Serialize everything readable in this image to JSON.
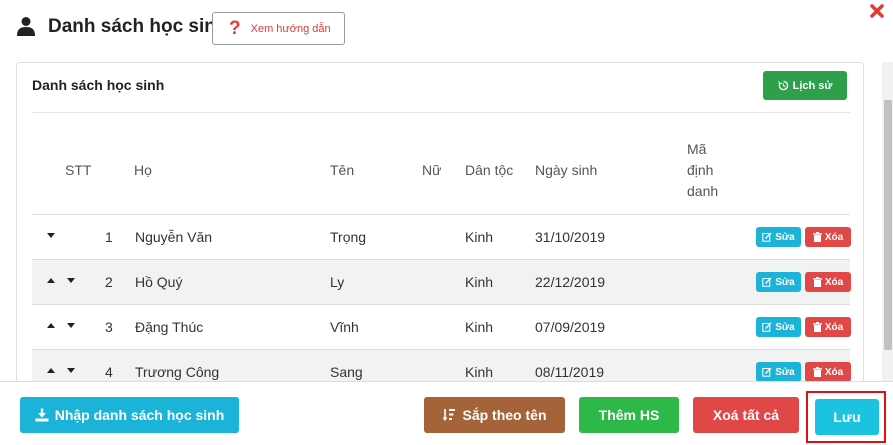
{
  "header": {
    "title": "Danh sách học sinh",
    "help_label": "Xem hướng dẫn",
    "help_mark": "?"
  },
  "panel": {
    "title": "Danh sách học sinh",
    "history_label": "Lịch sử"
  },
  "table": {
    "columns": {
      "stt": "STT",
      "ho": "Họ",
      "ten": "Tên",
      "nu": "Nữ",
      "dan_toc": "Dân tộc",
      "ngay_sinh": "Ngày sinh",
      "ma_1": "Mã",
      "ma_2": "định",
      "ma_3": "danh"
    },
    "rows": [
      {
        "stt": "1",
        "ho": "Nguyễn Văn",
        "ten": "Trọng",
        "dan_toc": "Kinh",
        "ngay_sinh": "31/10/2019",
        "edit": "Sửa",
        "delete": "Xóa"
      },
      {
        "stt": "2",
        "ho": "Hồ Quý",
        "ten": "Ly",
        "dan_toc": "Kinh",
        "ngay_sinh": "22/12/2019",
        "edit": "Sửa",
        "delete": "Xóa"
      },
      {
        "stt": "3",
        "ho": "Đặng Thúc",
        "ten": "Vĩnh",
        "dan_toc": "Kinh",
        "ngay_sinh": "07/09/2019",
        "edit": "Sửa",
        "delete": "Xóa"
      },
      {
        "stt": "4",
        "ho": "Trương Công",
        "ten": "Sang",
        "dan_toc": "Kinh",
        "ngay_sinh": "08/11/2019",
        "edit": "Sửa",
        "delete": "Xóa"
      }
    ]
  },
  "footer": {
    "import_label": "Nhập danh sách học sinh",
    "sort_label": "Sắp theo tên",
    "add_label": "Thêm HS",
    "clear_label": "Xoá tất cả",
    "save_label": "Lưu"
  },
  "icons": {
    "user": "user-icon",
    "close": "close-icon",
    "history": "history-icon",
    "edit": "edit-icon",
    "delete": "trash-icon",
    "import": "download-icon",
    "sort": "sort-icon",
    "move_up": "triangle-up-icon",
    "move_down": "triangle-down-icon"
  },
  "colors": {
    "primary_cyan": "#1cb3d8",
    "success_green": "#2e9f4a",
    "danger_red": "#e04848",
    "sort_brown": "#a5633a",
    "highlight_border": "#e01010"
  }
}
